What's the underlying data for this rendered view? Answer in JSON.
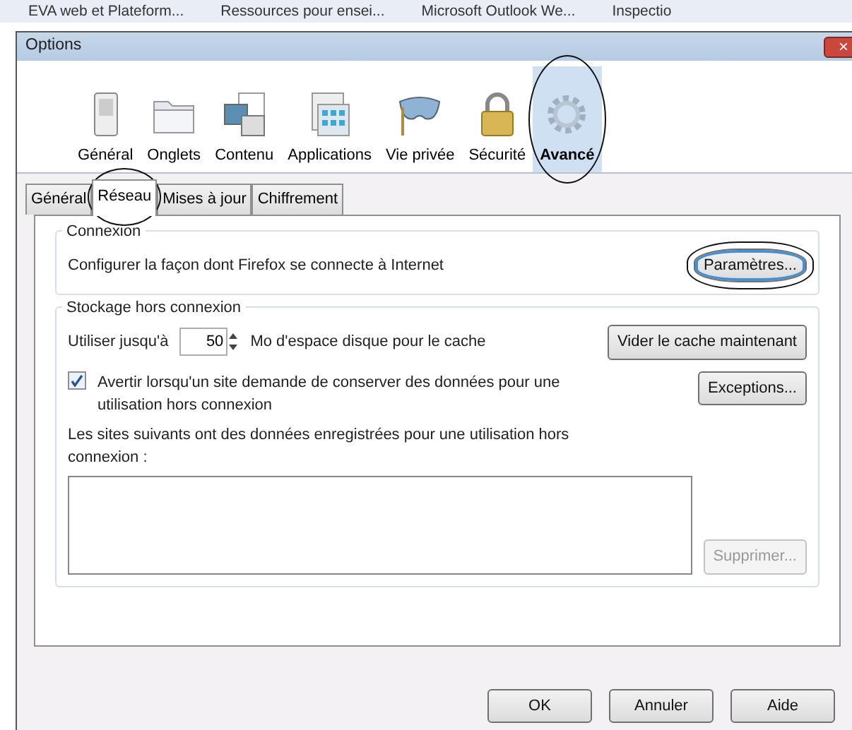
{
  "bookmarks": [
    {
      "label": "EVA web et Plateform..."
    },
    {
      "label": "Ressources pour ensei..."
    },
    {
      "label": "Microsoft Outlook We..."
    },
    {
      "label": "Inspectio"
    }
  ],
  "window": {
    "title": "Options",
    "close": "×"
  },
  "toolbar": [
    {
      "label": "Général",
      "selected": false,
      "circled": false
    },
    {
      "label": "Onglets",
      "selected": false,
      "circled": false
    },
    {
      "label": "Contenu",
      "selected": false,
      "circled": false
    },
    {
      "label": "Applications",
      "selected": false,
      "circled": false
    },
    {
      "label": "Vie privée",
      "selected": false,
      "circled": false
    },
    {
      "label": "Sécurité",
      "selected": false,
      "circled": false
    },
    {
      "label": "Avancé",
      "selected": true,
      "circled": true
    }
  ],
  "tabs": [
    {
      "label": "Général",
      "selected": false,
      "circled": false
    },
    {
      "label": "Réseau",
      "selected": true,
      "circled": true
    },
    {
      "label": "Mises à jour",
      "selected": false,
      "circled": false
    },
    {
      "label": "Chiffrement",
      "selected": false,
      "circled": false
    }
  ],
  "connexion": {
    "legend": "Connexion",
    "text": "Configurer la façon dont Firefox se connecte à Internet",
    "button": {
      "label": "Paramètres...",
      "disabled": false,
      "circled": true
    }
  },
  "storage": {
    "legend": "Stockage hors connexion",
    "use_label": "Utiliser jusqu'à",
    "cache_size": "50",
    "cache_unit": "Mo d'espace disque pour le cache",
    "clear_button": {
      "label": "Vider le cache maintenant",
      "disabled": false
    },
    "warn": {
      "label": "Avertir lorsqu'un site demande de conserver des données pour une utilisation hors connexion",
      "checked": true
    },
    "exceptions_button": {
      "label": "Exceptions...",
      "disabled": false
    },
    "sites_label": "Les sites suivants ont des données enregistrées pour une utilisation hors connexion :",
    "remove_button": {
      "label": "Supprimer...",
      "disabled": true
    }
  },
  "footer": [
    {
      "label": "OK",
      "disabled": false
    },
    {
      "label": "Annuler",
      "disabled": false
    },
    {
      "label": "Aide",
      "disabled": false
    }
  ]
}
